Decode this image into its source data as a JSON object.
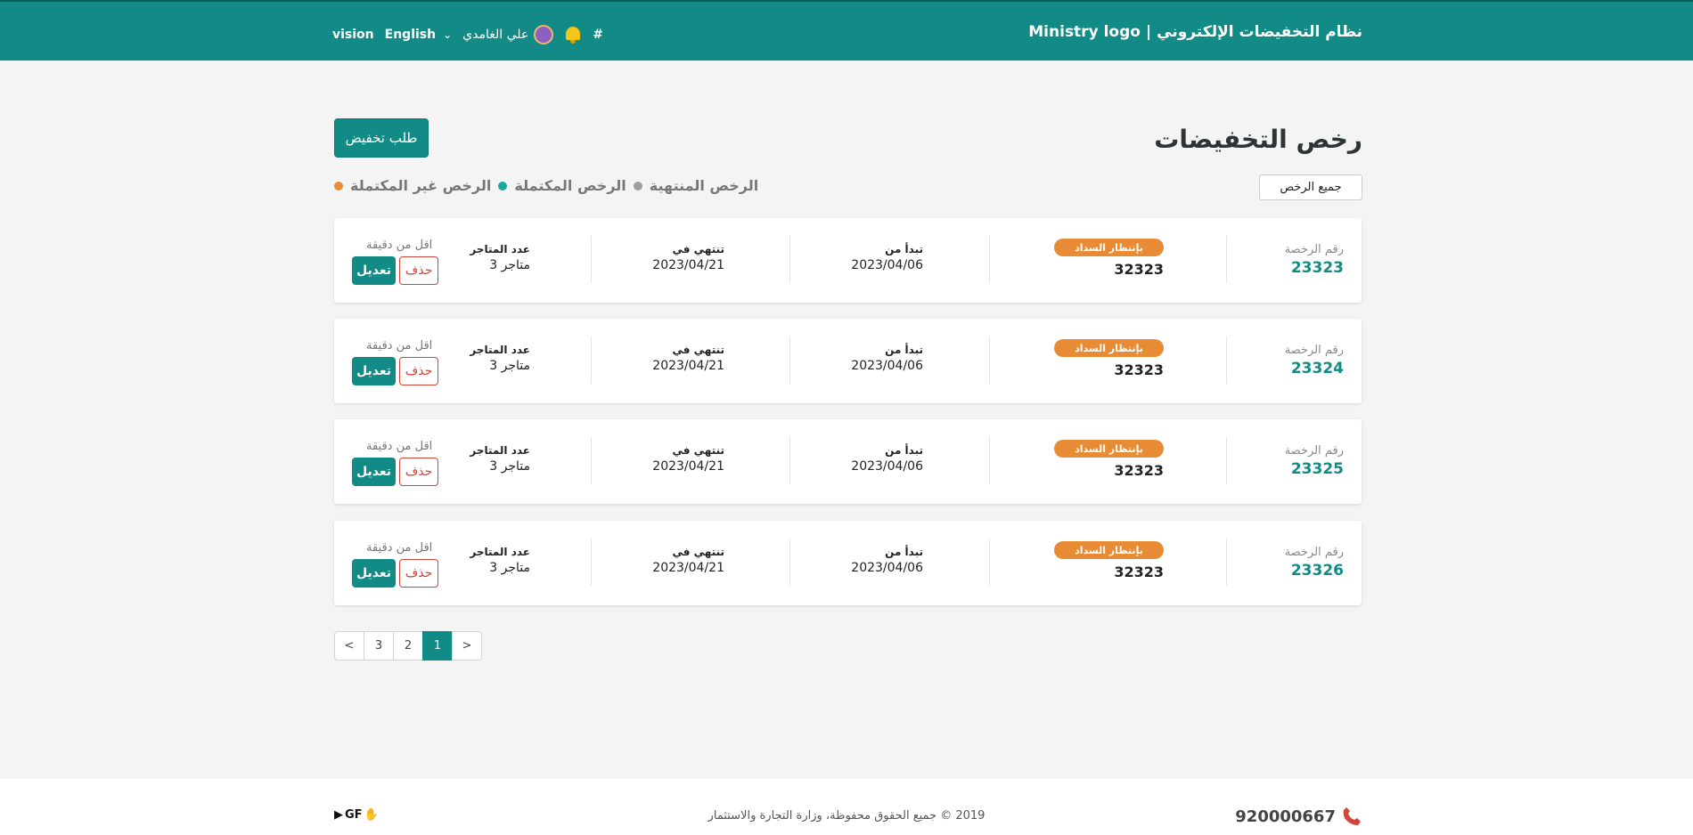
{
  "header": {
    "title": "نظام التخفيضات الإلكتروني",
    "separator": "|",
    "logo_text": "Ministry logo",
    "vision": "vision",
    "language": "English",
    "user_name": "علي الغامدي",
    "hash": "#"
  },
  "page": {
    "title": "رخص التخفيضات",
    "request_button": "طلب تخفيض",
    "all_button": "جميع الرخص"
  },
  "legend": [
    {
      "label": "الرخص المنتهية",
      "color": "#9e9e9e"
    },
    {
      "label": "الرخص المكتملة",
      "color": "#1aa9a0"
    },
    {
      "label": "الرخص غير المكتملة",
      "color": "#e88b35"
    }
  ],
  "labels": {
    "license_number": "رقم الرخصة",
    "starts": "تبدأ من",
    "ends": "تنتهي في",
    "stores": "عدد المتاجر",
    "edit": "تعديل",
    "delete": "حذف"
  },
  "licenses": [
    {
      "number": "23323",
      "status": "بإنتظار السداد",
      "code": "32323",
      "start": "2023/04/06",
      "end": "2023/04/21",
      "stores": "3 متاجر",
      "time": "اقل من دقيقة"
    },
    {
      "number": "23324",
      "status": "بإنتظار السداد",
      "code": "32323",
      "start": "2023/04/06",
      "end": "2023/04/21",
      "stores": "3 متاجر",
      "time": "اقل من دقيقة"
    },
    {
      "number": "23325",
      "status": "بإنتظار السداد",
      "code": "32323",
      "start": "2023/04/06",
      "end": "2023/04/21",
      "stores": "3 متاجر",
      "time": "اقل من دقيقة"
    },
    {
      "number": "23326",
      "status": "بإنتظار السداد",
      "code": "32323",
      "start": "2023/04/06",
      "end": "2023/04/21",
      "stores": "3 متاجر",
      "time": "اقل من دقيقة"
    }
  ],
  "pagination": [
    "<",
    "3",
    "2",
    "1",
    ">"
  ],
  "pagination_active": "1",
  "footer": {
    "copyright": "2019 © جميع الحقوق محفوظة، وزارة التجارة والاستثمار",
    "phone": "920000667",
    "gf": "GF"
  },
  "colors": {
    "primary": "#128a85",
    "pending": "#e88b35",
    "delete": "#d0463b"
  }
}
